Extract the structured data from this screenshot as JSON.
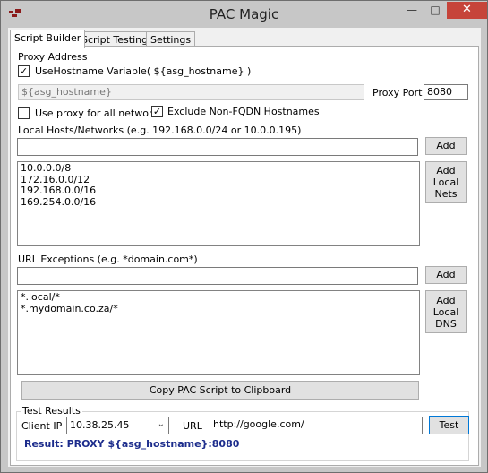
{
  "window": {
    "title": "PAC Magic"
  },
  "tabs": [
    {
      "label": "Script Builder"
    },
    {
      "label": "Script Testing"
    },
    {
      "label": "Settings"
    }
  ],
  "proxy": {
    "section_label": "Proxy Address",
    "use_hostname_label": "UseHostname Variable( ${asg_hostname} )",
    "use_hostname_checked": true,
    "address_value": "${asg_hostname}",
    "port_label": "Proxy Port",
    "port_value": "8080",
    "all_networks_label": "Use proxy for all networks",
    "all_networks_checked": false,
    "exclude_fqdn_label": "Exclude Non-FQDN Hostnames",
    "exclude_fqdn_checked": true
  },
  "local": {
    "label": "Local Hosts/Networks (e.g. 192.168.0.0/24 or 10.0.0.195)",
    "input_value": "",
    "add_label": "Add",
    "add_local_label_lines": [
      "Add",
      "Local",
      "Nets"
    ],
    "items": [
      "10.0.0.0/8",
      "172.16.0.0/12",
      "192.168.0.0/16",
      "169.254.0.0/16"
    ]
  },
  "exceptions": {
    "label": "URL Exceptions (e.g. *domain.com*)",
    "input_value": "",
    "add_label": "Add",
    "add_local_label_lines": [
      "Add",
      "Local",
      "DNS"
    ],
    "items": [
      "*.local/*",
      "*.mydomain.co.za/*"
    ]
  },
  "copy_label": "Copy PAC Script to Clipboard",
  "test": {
    "group_label": "Test Results",
    "client_ip_label": "Client IP",
    "client_ip_value": "10.38.25.45",
    "url_label": "URL",
    "url_value": "http://google.com/",
    "test_label": "Test",
    "result_text": "Result:  PROXY ${asg_hostname}:8080"
  },
  "colors": {
    "close_button": "#c6443a",
    "result_text": "#1c2c8c",
    "focus_border": "#0078d7"
  },
  "icons": [
    "app-icon",
    "minimize-icon",
    "maximize-icon",
    "close-icon",
    "chevron-down-icon",
    "checkmark-icon"
  ]
}
